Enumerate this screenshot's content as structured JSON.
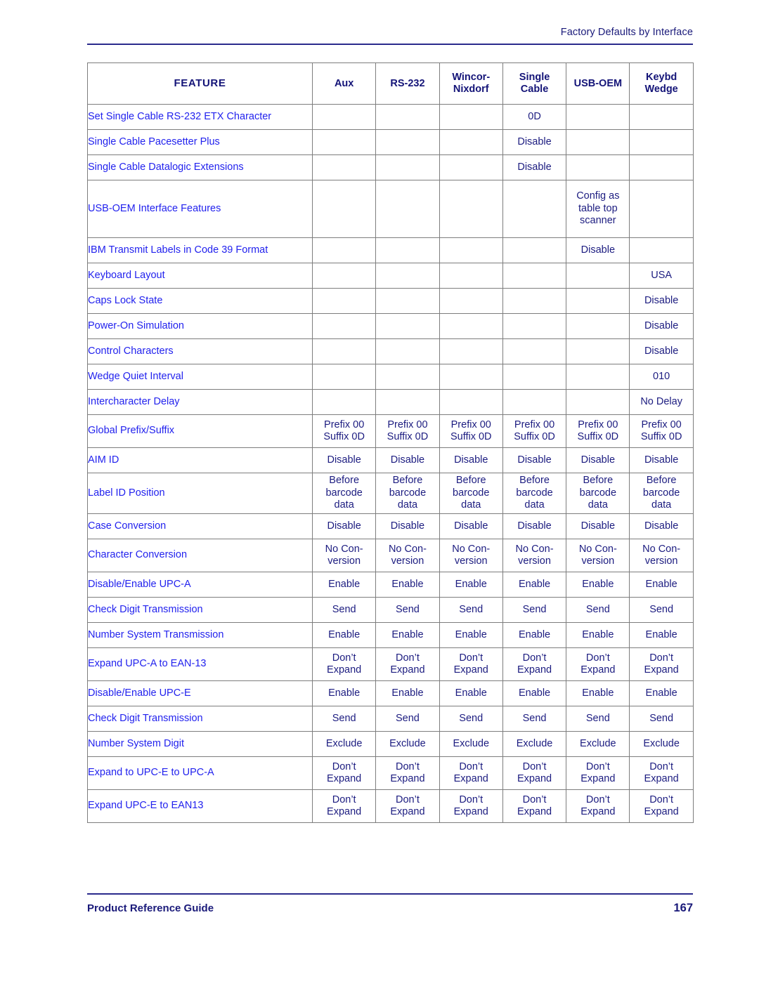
{
  "running_head": "Factory Defaults by Interface",
  "footer": {
    "guide_label": "Product Reference Guide",
    "page_number": "167"
  },
  "colors": {
    "feature_text": "#2222ee",
    "value_text": "#1c1c80",
    "header_text": "#141478",
    "rule": "#2a2a8c",
    "border": "#7d7d7d"
  },
  "table": {
    "columns": [
      "FEATURE",
      "Aux",
      "RS-232",
      "Wincor-\nNixdorf",
      "Single\nCable",
      "USB-OEM",
      "Keybd\nWedge"
    ],
    "column_lines": [
      [
        "FEATURE"
      ],
      [
        "Aux"
      ],
      [
        "RS-232"
      ],
      [
        "Wincor-",
        "Nixdorf"
      ],
      [
        "Single",
        "Cable"
      ],
      [
        "USB-OEM"
      ],
      [
        "Keybd",
        "Wedge"
      ]
    ],
    "rows": [
      {
        "feature": "Set Single Cable RS-232 ETX Character",
        "size": "r1",
        "values": [
          "",
          "",
          "",
          "0D",
          "",
          ""
        ]
      },
      {
        "feature": "Single Cable Pacesetter Plus",
        "size": "r1",
        "values": [
          "",
          "",
          "",
          "Disable",
          "",
          ""
        ]
      },
      {
        "feature": "Single Cable Datalogic Extensions",
        "size": "r1",
        "values": [
          "",
          "",
          "",
          "Disable",
          "",
          ""
        ]
      },
      {
        "feature": "USB-OEM Interface Features",
        "size": "r4",
        "values": [
          "",
          "",
          "",
          "",
          "Config as\ntable top\nscanner",
          ""
        ]
      },
      {
        "feature": "IBM Transmit Labels in Code 39 Format",
        "size": "r1",
        "values": [
          "",
          "",
          "",
          "",
          "Disable",
          ""
        ]
      },
      {
        "feature": "Keyboard Layout",
        "size": "r1",
        "values": [
          "",
          "",
          "",
          "",
          "",
          "USA"
        ]
      },
      {
        "feature": "Caps Lock State",
        "size": "r1",
        "values": [
          "",
          "",
          "",
          "",
          "",
          "Disable"
        ]
      },
      {
        "feature": "Power-On Simulation",
        "size": "r1",
        "values": [
          "",
          "",
          "",
          "",
          "",
          "Disable"
        ]
      },
      {
        "feature": "Control Characters",
        "size": "r1",
        "values": [
          "",
          "",
          "",
          "",
          "",
          "Disable"
        ]
      },
      {
        "feature": "Wedge Quiet Interval",
        "size": "r1",
        "values": [
          "",
          "",
          "",
          "",
          "",
          "010"
        ]
      },
      {
        "feature": "Intercharacter Delay",
        "size": "r1",
        "values": [
          "",
          "",
          "",
          "",
          "",
          "No Delay"
        ]
      },
      {
        "feature": "Global Prefix/Suffix",
        "size": "r2",
        "values": [
          "Prefix 00\nSuffix 0D",
          "Prefix 00\nSuffix 0D",
          "Prefix 00\nSuffix 0D",
          "Prefix 00\nSuffix 0D",
          "Prefix 00\nSuffix 0D",
          "Prefix 00\nSuffix 0D"
        ]
      },
      {
        "feature": "AIM ID",
        "size": "r1",
        "values": [
          "Disable",
          "Disable",
          "Disable",
          "Disable",
          "Disable",
          "Disable"
        ]
      },
      {
        "feature": "Label ID Position",
        "size": "r3",
        "values": [
          "Before\nbarcode\ndata",
          "Before\nbarcode\ndata",
          "Before\nbarcode\ndata",
          "Before\nbarcode\ndata",
          "Before\nbarcode\ndata",
          "Before\nbarcode\ndata"
        ]
      },
      {
        "feature": "Case Conversion",
        "size": "r1",
        "values": [
          "Disable",
          "Disable",
          "Disable",
          "Disable",
          "Disable",
          "Disable"
        ]
      },
      {
        "feature": "Character Conversion",
        "size": "r2",
        "values": [
          "No Con-\nversion",
          "No Con-\nversion",
          "No Con-\nversion",
          "No Con-\nversion",
          "No Con-\nversion",
          "No Con-\nversion"
        ]
      },
      {
        "feature": "Disable/Enable UPC-A",
        "size": "r1",
        "values": [
          "Enable",
          "Enable",
          "Enable",
          "Enable",
          "Enable",
          "Enable"
        ]
      },
      {
        "feature": "Check Digit Transmission",
        "size": "r1",
        "values": [
          "Send",
          "Send",
          "Send",
          "Send",
          "Send",
          "Send"
        ]
      },
      {
        "feature": "Number System Transmission",
        "size": "r1",
        "values": [
          "Enable",
          "Enable",
          "Enable",
          "Enable",
          "Enable",
          "Enable"
        ]
      },
      {
        "feature": "Expand UPC-A to EAN-13",
        "size": "r2",
        "values": [
          "Don’t\nExpand",
          "Don’t\nExpand",
          "Don’t\nExpand",
          "Don’t\nExpand",
          "Don’t\nExpand",
          "Don’t\nExpand"
        ]
      },
      {
        "feature": "Disable/Enable UPC-E",
        "size": "r1",
        "values": [
          "Enable",
          "Enable",
          "Enable",
          "Enable",
          "Enable",
          "Enable"
        ]
      },
      {
        "feature": "Check Digit Transmission",
        "size": "r1",
        "values": [
          "Send",
          "Send",
          "Send",
          "Send",
          "Send",
          "Send"
        ]
      },
      {
        "feature": "Number System Digit",
        "size": "r1",
        "values": [
          "Exclude",
          "Exclude",
          "Exclude",
          "Exclude",
          "Exclude",
          "Exclude"
        ]
      },
      {
        "feature": "Expand to UPC-E to UPC-A",
        "size": "r2",
        "values": [
          "Don’t\nExpand",
          "Don’t\nExpand",
          "Don’t\nExpand",
          "Don’t\nExpand",
          "Don’t\nExpand",
          "Don’t\nExpand"
        ]
      },
      {
        "feature": "Expand UPC-E to EAN13",
        "size": "r2",
        "values": [
          "Don’t\nExpand",
          "Don’t\nExpand",
          "Don’t\nExpand",
          "Don’t\nExpand",
          "Don’t\nExpand",
          "Don’t\nExpand"
        ]
      }
    ]
  }
}
